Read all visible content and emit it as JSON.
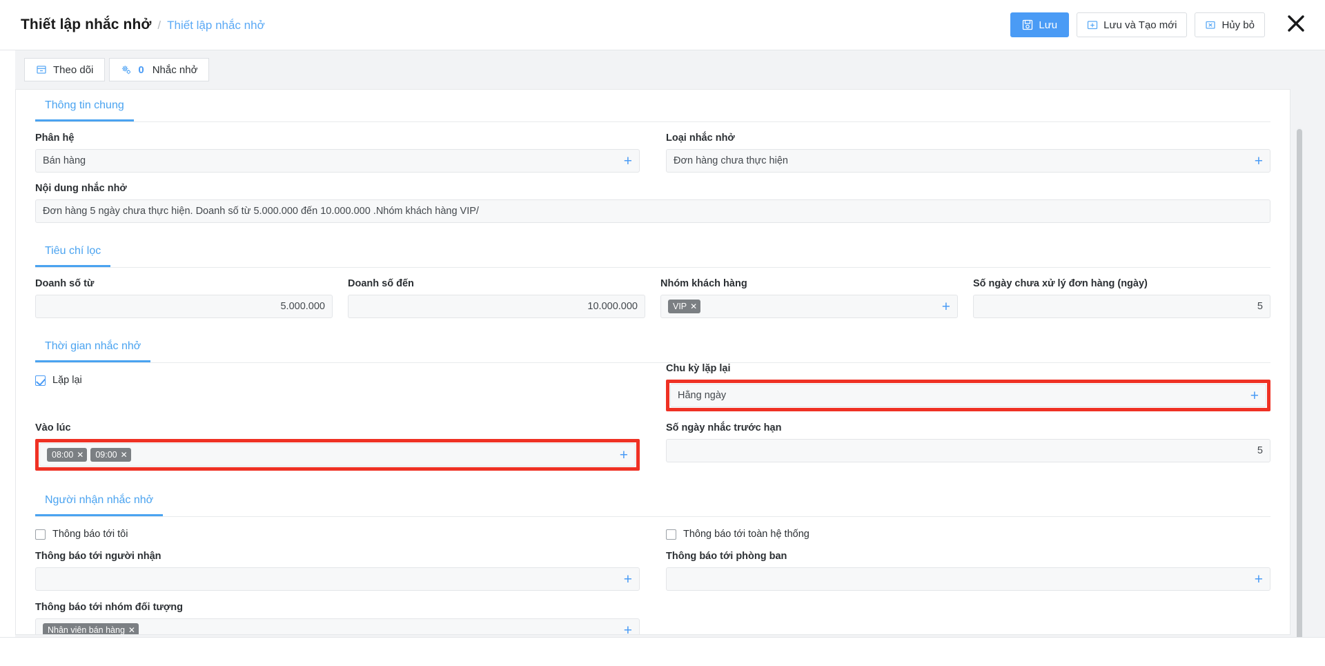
{
  "header": {
    "title": "Thiết lập nhắc nhở",
    "separator": "/",
    "current": "Thiết lập nhắc nhở",
    "buttons": {
      "save": "Lưu",
      "save_icon": "save-disk-icon",
      "save_new": "Lưu và Tạo mới",
      "save_new_icon": "save-add-icon",
      "cancel": "Hủy bỏ",
      "cancel_icon": "cancel-box-icon",
      "close_icon": "close-x-icon"
    }
  },
  "toolbar": {
    "follow": {
      "label": "Theo dõi",
      "icon": "panel-icon"
    },
    "reminder": {
      "count": "0",
      "label": "Nhắc nhở",
      "icon": "gears-icon"
    }
  },
  "sections": {
    "general": {
      "tab": "Thông tin chung",
      "fields": {
        "module": {
          "label": "Phân hệ",
          "value": "Bán hàng",
          "add_icon": "plus-icon"
        },
        "reminder_type": {
          "label": "Loại nhắc nhở",
          "value": "Đơn hàng chưa thực hiện",
          "add_icon": "plus-icon"
        },
        "content": {
          "label": "Nội dung nhắc nhở",
          "value": "Đơn hàng 5 ngày chưa thực hiện. Doanh số từ 5.000.000 đến 10.000.000 .Nhóm khách hàng VIP/"
        }
      }
    },
    "filter": {
      "tab": "Tiêu chí lọc",
      "fields": {
        "revenue_from": {
          "label": "Doanh số từ",
          "value": "5.000.000"
        },
        "revenue_to": {
          "label": "Doanh số đến",
          "value": "10.000.000"
        },
        "customer_group": {
          "label": "Nhóm khách hàng",
          "chips": [
            {
              "text": "VIP",
              "remove_icon": "chip-remove-icon"
            }
          ],
          "add_icon": "plus-icon"
        },
        "unprocessed_days": {
          "label": "Số ngày chưa xử lý đơn hàng (ngày)",
          "value": "5"
        }
      }
    },
    "schedule": {
      "tab": "Thời gian nhắc nhở",
      "fields": {
        "repeat": {
          "label": "Lặp lại",
          "checked": true
        },
        "repeat_cycle": {
          "label": "Chu kỳ lặp lại",
          "value": "Hằng ngày",
          "add_icon": "plus-icon",
          "highlighted": true
        },
        "at_time": {
          "label": "Vào lúc",
          "chips": [
            {
              "text": "08:00",
              "remove_icon": "chip-remove-icon"
            },
            {
              "text": "09:00",
              "remove_icon": "chip-remove-icon"
            }
          ],
          "add_icon": "plus-icon",
          "highlighted": true
        },
        "days_before": {
          "label": "Số ngày nhắc trước hạn",
          "value": "5"
        }
      }
    },
    "recipients": {
      "tab": "Người nhận nhắc nhở",
      "fields": {
        "notify_me": {
          "label": "Thông báo tới tôi",
          "checked": false
        },
        "notify_all": {
          "label": "Thông báo tới toàn hệ thống",
          "checked": false
        },
        "notify_person": {
          "label": "Thông báo tới người nhận",
          "value": "",
          "add_icon": "plus-icon"
        },
        "notify_dept": {
          "label": "Thông báo tới phòng ban",
          "value": "",
          "add_icon": "plus-icon"
        },
        "notify_group": {
          "label": "Thông báo tới nhóm đối tượng",
          "chips": [
            {
              "text": "Nhân viên bán hàng",
              "remove_icon": "chip-remove-icon"
            }
          ],
          "add_icon": "plus-icon"
        }
      }
    }
  },
  "colors": {
    "accent": "#4a9bf5",
    "highlight": "#ef3124",
    "chip": "#7b7f83",
    "field_bg": "#f7f8f9"
  }
}
